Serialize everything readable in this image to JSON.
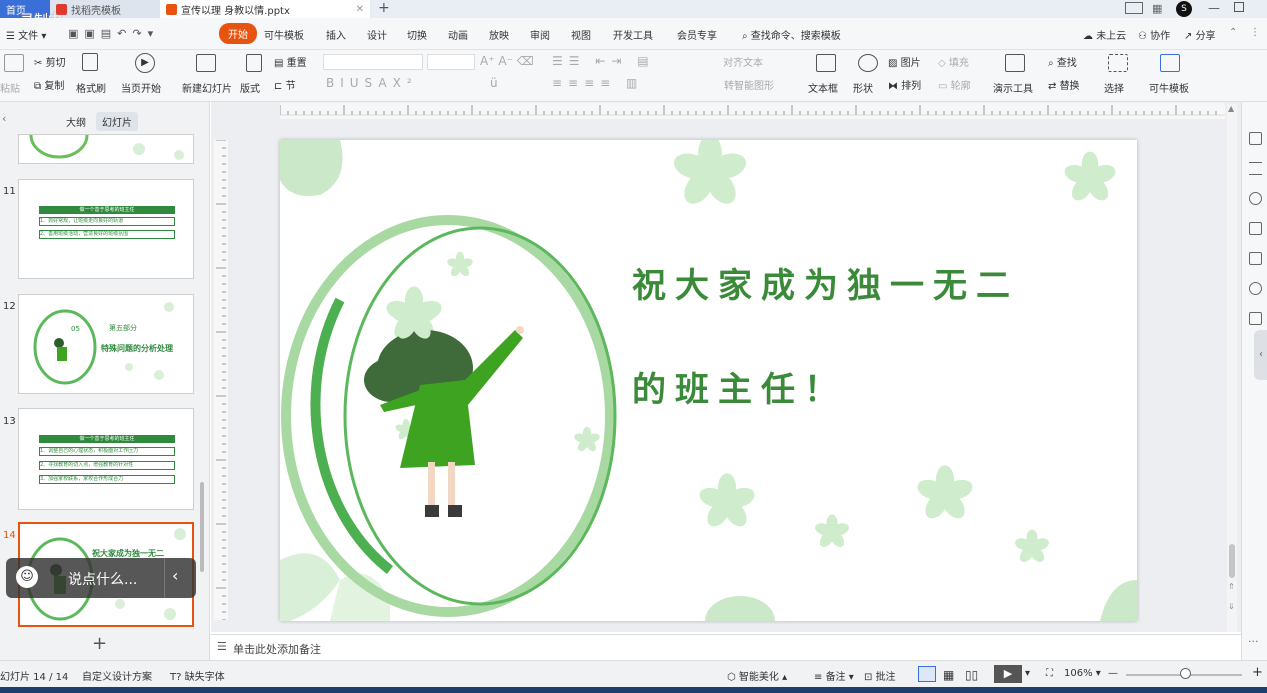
{
  "titlebar": {
    "tabs": [
      {
        "label": "首页"
      },
      {
        "label": "找稻壳模板"
      },
      {
        "label": "宣传以理 身教以情.pptx"
      }
    ],
    "watermark": "录制中",
    "right": {
      "account_initial": "S"
    }
  },
  "menu": {
    "file": "文件",
    "items": [
      "开始",
      "可牛模板",
      "插入",
      "设计",
      "切换",
      "动画",
      "放映",
      "审阅",
      "视图",
      "开发工具",
      "会员专享"
    ],
    "search_placeholder": "查找命令、搜索模板",
    "cloud": "未上云",
    "collab": "协作",
    "share": "分享"
  },
  "ribbon": {
    "paste": "粘贴",
    "cut": "剪切",
    "copy": "复制",
    "format_painter": "格式刷",
    "from_current": "当页开始",
    "new_slide": "新建幻灯片",
    "layout": "版式",
    "reset": "重置",
    "section": "节",
    "align_text": "对齐文本",
    "convert_smartart": "转智能图形",
    "textbox": "文本框",
    "shape": "形状",
    "picture": "图片",
    "fill": "填充",
    "arrange": "排列",
    "outline": "轮廓",
    "presenter_tools": "演示工具",
    "find": "查找",
    "replace": "替换",
    "select": "选择",
    "kn_template": "可牛模板"
  },
  "panel": {
    "tabs": [
      "大纲",
      "幻灯片"
    ],
    "slides": [
      {
        "num": "11",
        "title": "做一个善于思考的班主任",
        "lines": [
          "1、抓好常规，让班级走向良好的轨道",
          "2、善用班级活动，营造良好的班级氛围"
        ]
      },
      {
        "num": "12",
        "part": "第五部分",
        "badge": "05",
        "title": "特殊问题的分析处理"
      },
      {
        "num": "13",
        "title": "做一个善于思考的班主任",
        "lines": [
          "1、调整自己的心理状态，积极面对工作压力",
          "2、寻找教育的切入点，增强教育的针对性",
          "3、加强家校联系，家校合作形成合力"
        ]
      },
      {
        "num": "14",
        "text": "祝大家成为独一无二"
      }
    ],
    "add": "+"
  },
  "chat": {
    "placeholder": "说点什么..."
  },
  "slide": {
    "line1": "祝大家成为独一无二",
    "line2": "的班主任！"
  },
  "notes": {
    "placeholder": "单击此处添加备注"
  },
  "status": {
    "slide_counter": "幻灯片 14 / 14",
    "design": "自定义设计方案",
    "missing_font": "缺失字体",
    "beautify": "智能美化",
    "notes": "备注",
    "comments": "批注",
    "zoom": "106%"
  },
  "colors": {
    "accent": "#e8540f",
    "slide_green": "#3a8a3a",
    "dress_green": "#3fa322",
    "light_green": "#c8e8c6"
  }
}
